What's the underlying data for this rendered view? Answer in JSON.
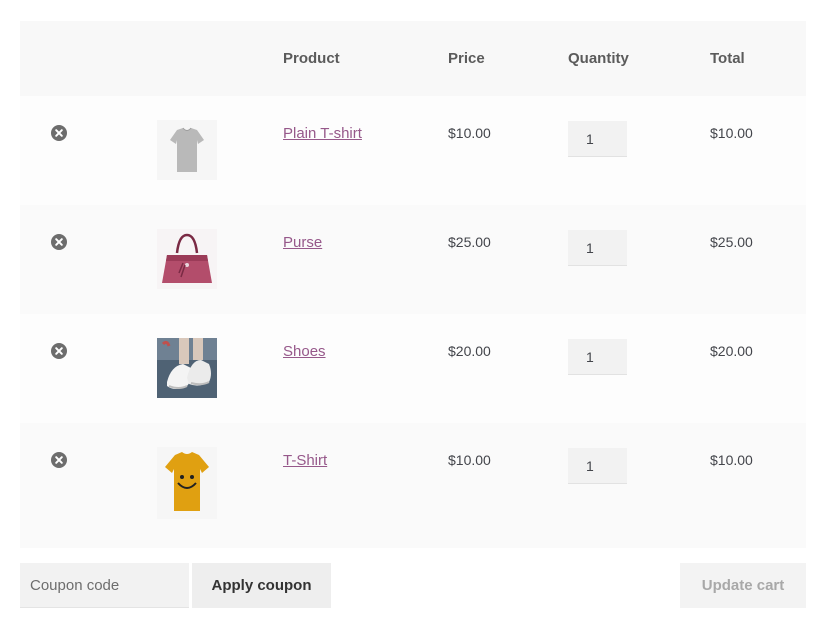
{
  "table": {
    "headers": {
      "product": "Product",
      "price": "Price",
      "quantity": "Quantity",
      "total": "Total"
    }
  },
  "items": [
    {
      "name": "Plain T-shirt",
      "price": "$10.00",
      "quantity": "1",
      "total": "$10.00",
      "image": "gray-tshirt"
    },
    {
      "name": "Purse",
      "price": "$25.00",
      "quantity": "1",
      "total": "$25.00",
      "image": "pink-handbag"
    },
    {
      "name": "Shoes",
      "price": "$20.00",
      "quantity": "1",
      "total": "$20.00",
      "image": "white-sneakers"
    },
    {
      "name": "T-Shirt",
      "price": "$10.00",
      "quantity": "1",
      "total": "$10.00",
      "image": "yellow-smiley-tshirt"
    }
  ],
  "actions": {
    "coupon_placeholder": "Coupon code",
    "apply_label": "Apply coupon",
    "update_label": "Update cart"
  },
  "colors": {
    "link": "#96588a",
    "text": "#43454b",
    "remove_icon": "#6d6d6d"
  }
}
